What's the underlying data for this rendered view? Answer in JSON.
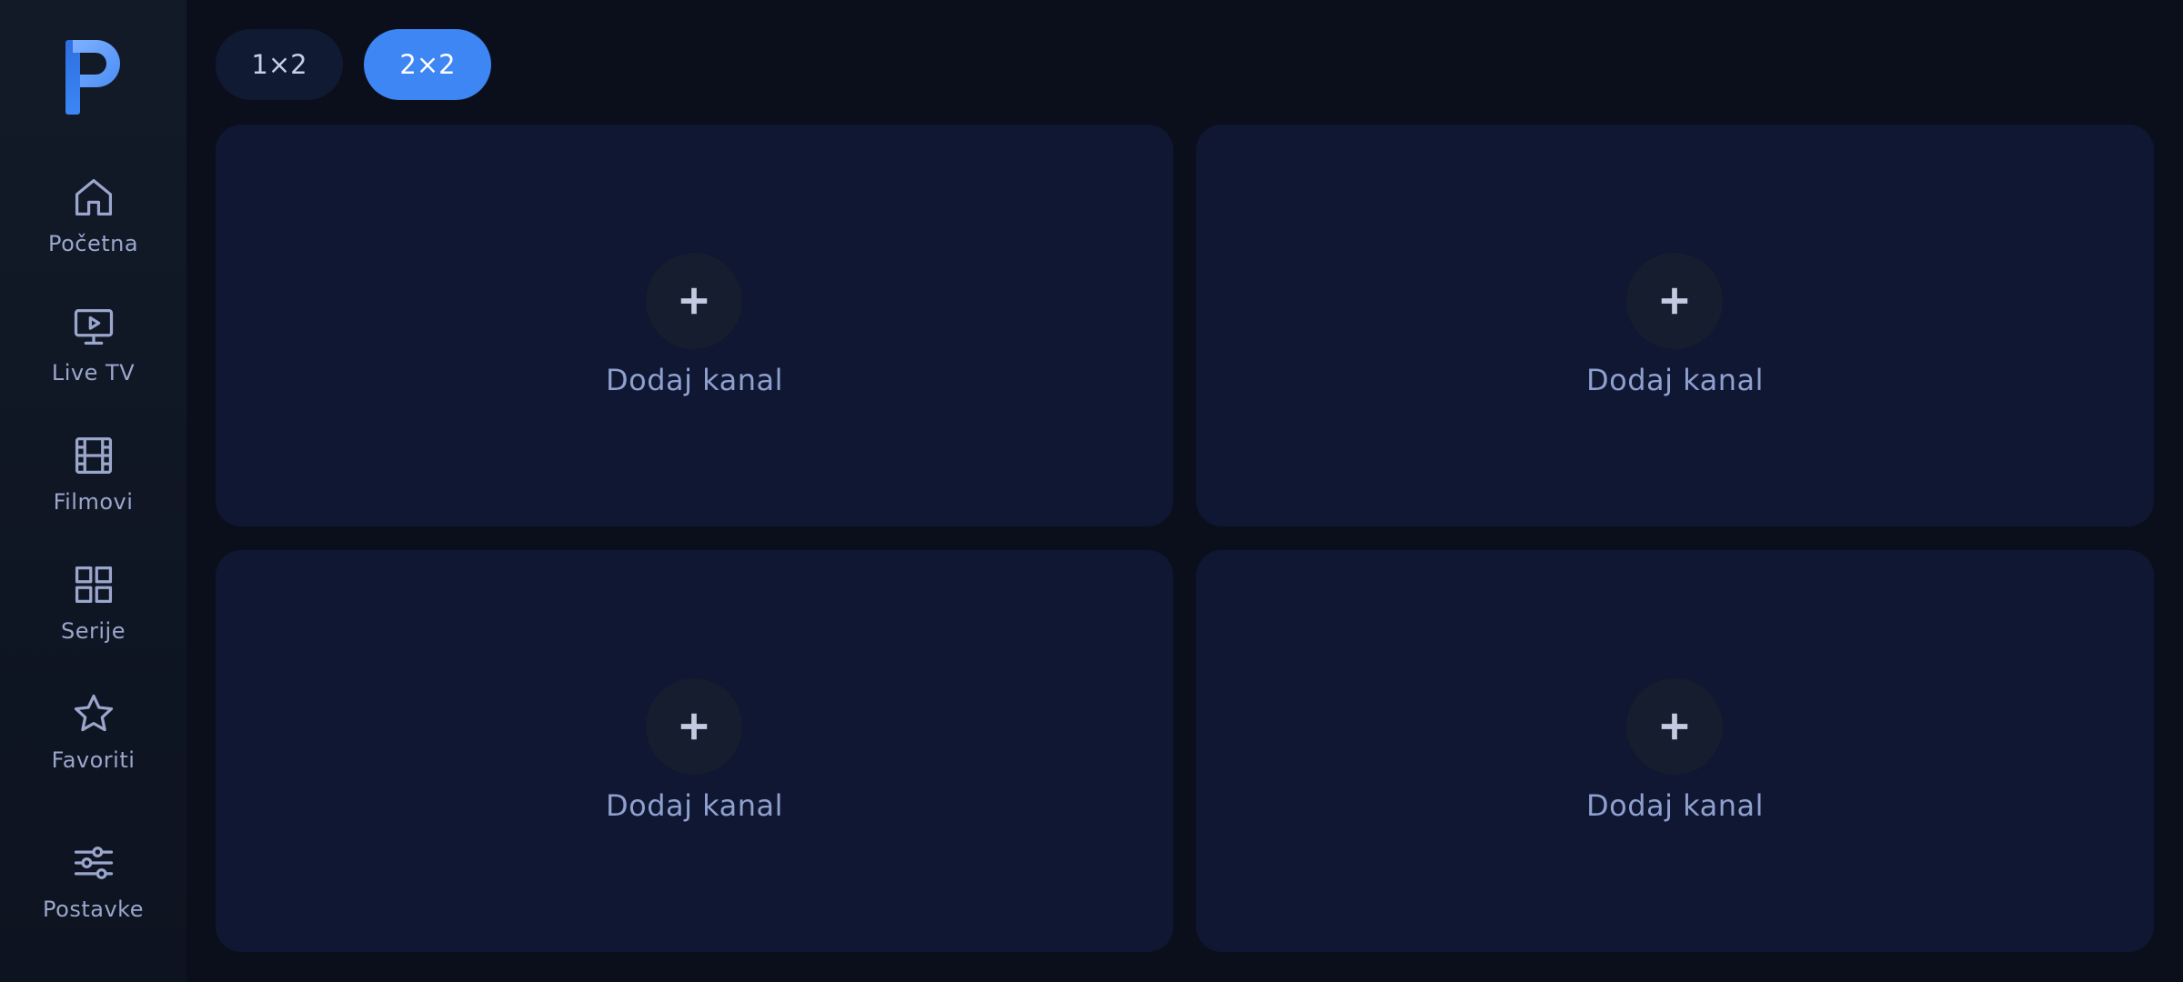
{
  "sidebar": {
    "logo_letter": "P",
    "items": [
      {
        "label": "Početna",
        "icon": "home-icon"
      },
      {
        "label": "Live TV",
        "icon": "tv-icon"
      },
      {
        "label": "Filmovi",
        "icon": "film-icon"
      },
      {
        "label": "Serije",
        "icon": "grid-icon"
      },
      {
        "label": "Favoriti",
        "icon": "star-icon"
      },
      {
        "label": "Postavke",
        "icon": "sliders-icon"
      }
    ]
  },
  "layout_toggle": {
    "options": [
      {
        "label": "1×2",
        "selected": false
      },
      {
        "label": "2×2",
        "selected": true
      }
    ]
  },
  "tiles": [
    {
      "label": "Dodaj kanal"
    },
    {
      "label": "Dodaj kanal"
    },
    {
      "label": "Dodaj kanal"
    },
    {
      "label": "Dodaj kanal"
    }
  ],
  "colors": {
    "accent": "#3d86f3",
    "background": "#0b0f1c",
    "tile": "#0f1732",
    "nav_text": "#9aa6cc"
  }
}
